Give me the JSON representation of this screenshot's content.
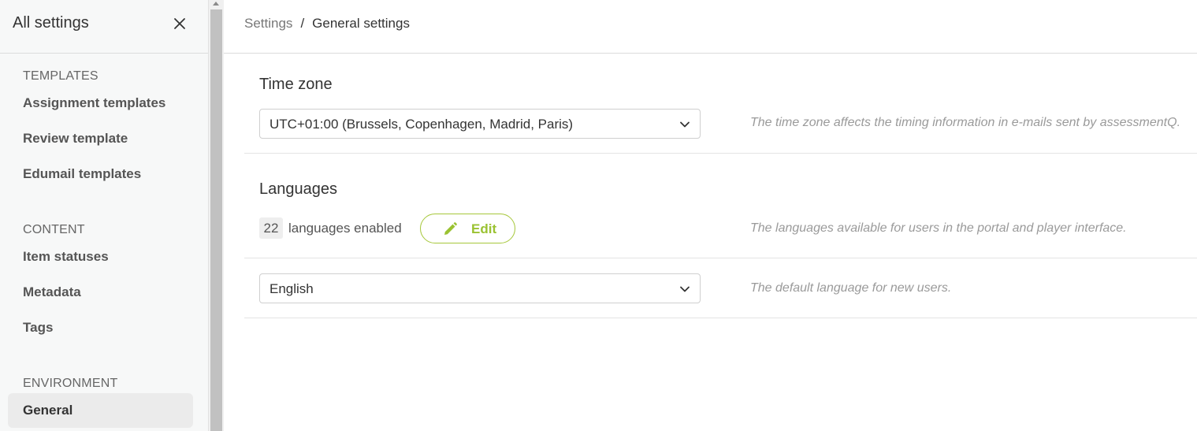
{
  "sidebar": {
    "title": "All settings",
    "sections": [
      {
        "heading": "TEMPLATES",
        "items": [
          "Assignment templates",
          "Review template",
          "Edumail templates"
        ]
      },
      {
        "heading": "CONTENT",
        "items": [
          "Item statuses",
          "Metadata",
          "Tags"
        ]
      },
      {
        "heading": "ENVIRONMENT",
        "items": [
          "General"
        ]
      }
    ],
    "active_item": "General"
  },
  "breadcrumb": {
    "parent": "Settings",
    "separator": "/",
    "current": "General settings"
  },
  "timezone": {
    "title": "Time zone",
    "value": "UTC+01:00 (Brussels, Copenhagen, Madrid, Paris)",
    "hint": "The time zone affects the timing information in e-mails sent by assessmentQ."
  },
  "languages": {
    "title": "Languages",
    "count": "22",
    "count_label": "languages enabled",
    "edit_label": "Edit",
    "hint": "The languages available for users in the portal and player interface.",
    "default_value": "English",
    "default_hint": "The default language for new users."
  },
  "colors": {
    "accent": "#9ac231",
    "accent_border": "#a6c73a"
  },
  "icons": {
    "close": "close-icon",
    "chevron": "chevron-down-icon",
    "edit": "pencil-icon"
  }
}
